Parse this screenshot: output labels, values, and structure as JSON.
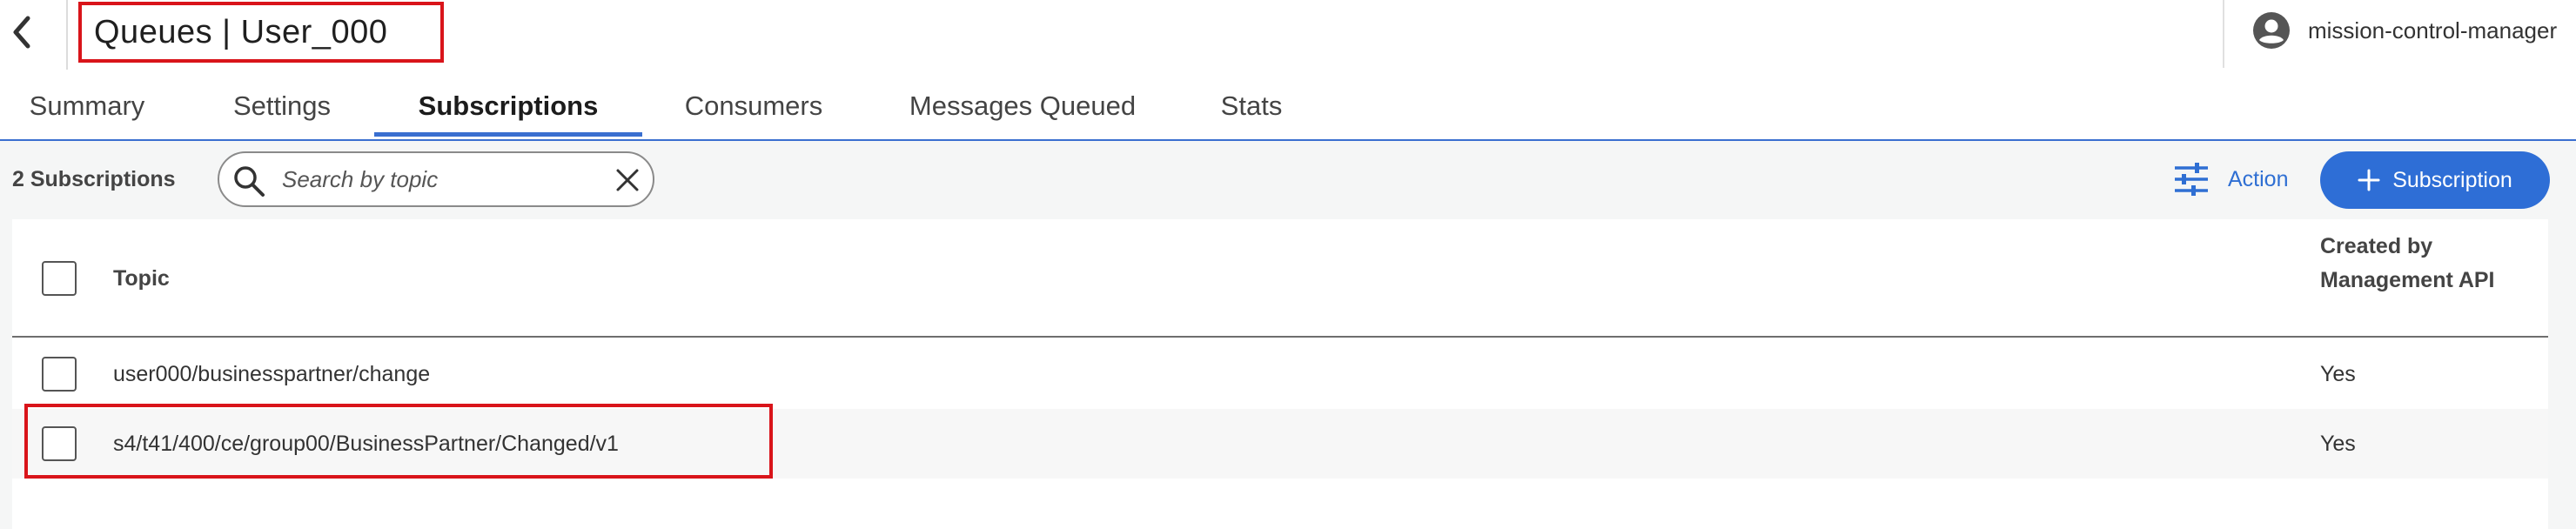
{
  "header": {
    "title": "Queues | User_000",
    "user_name": "mission-control-manager",
    "icons": {
      "back": "chevron-left-icon",
      "user": "account-circle-icon"
    }
  },
  "tabs": [
    {
      "label": "Summary",
      "active": false
    },
    {
      "label": "Settings",
      "active": false
    },
    {
      "label": "Subscriptions",
      "active": true
    },
    {
      "label": "Consumers",
      "active": false
    },
    {
      "label": "Messages Queued",
      "active": false
    },
    {
      "label": "Stats",
      "active": false
    }
  ],
  "toolbar": {
    "count_label": "2 Subscriptions",
    "search_placeholder": "Search by topic",
    "search_value": "",
    "action_label": "Action",
    "add_label": "Subscription",
    "icons": {
      "search": "search-icon",
      "clear": "close-icon",
      "action": "sliders-icon",
      "add": "plus-icon"
    }
  },
  "table": {
    "headers": {
      "topic": "Topic",
      "created_by": "Created by Management API"
    },
    "rows": [
      {
        "topic": "user000/businesspartner/change",
        "created_by": "Yes",
        "selected": false
      },
      {
        "topic": "s4/t41/400/ce/group00/BusinessPartner/Changed/v1",
        "created_by": "Yes",
        "selected": false
      }
    ]
  },
  "colors": {
    "accent": "#2e6ed6",
    "highlight_border": "#d9141a",
    "body_background": "#f5f6f6"
  }
}
